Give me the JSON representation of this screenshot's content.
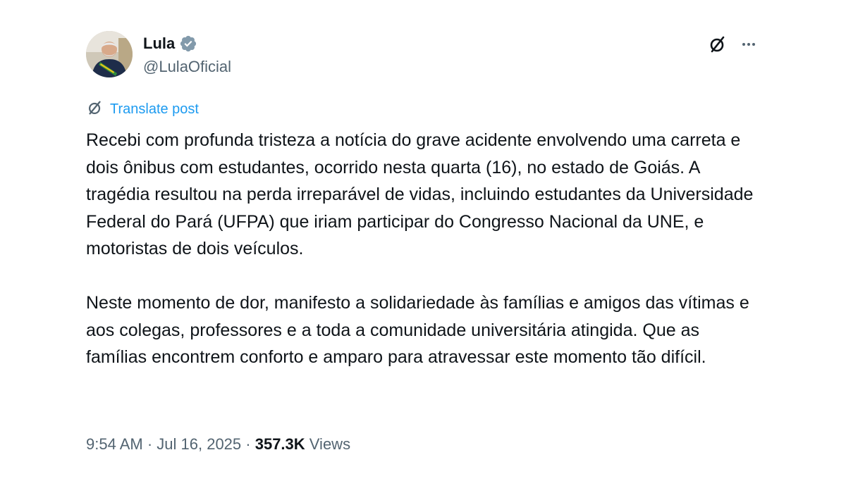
{
  "author": {
    "display_name": "Lula",
    "handle": "@LulaOficial",
    "verified_badge_color": "#829aab"
  },
  "icons": {
    "grok": "grok-icon",
    "more": "more-icon",
    "verified": "verified-badge-icon"
  },
  "translate": {
    "label": "Translate post",
    "color": "#1d9bf0"
  },
  "post": {
    "paragraph_1": "Recebi com profunda tristeza a notícia do grave acidente envolvendo uma carreta e dois ônibus com estudantes, ocorrido nesta quarta (16), no estado de Goiás. A tragédia resultou na perda irreparável de vidas, incluindo estudantes da Universidade Federal do Pará (UFPA) que iriam participar do Congresso Nacional da UNE, e motoristas de dois veículos.",
    "paragraph_2": "Neste momento de dor, manifesto a solidariedade às famílias e amigos das vítimas e aos colegas, professores e a toda a comunidade universitária atingida. Que as famílias encontrem conforto e amparo para atravessar este momento tão difícil."
  },
  "meta": {
    "time": "9:54 AM",
    "separator": " · ",
    "date": "Jul 16, 2025",
    "views_count": "357.3K",
    "views_label": " Views"
  }
}
